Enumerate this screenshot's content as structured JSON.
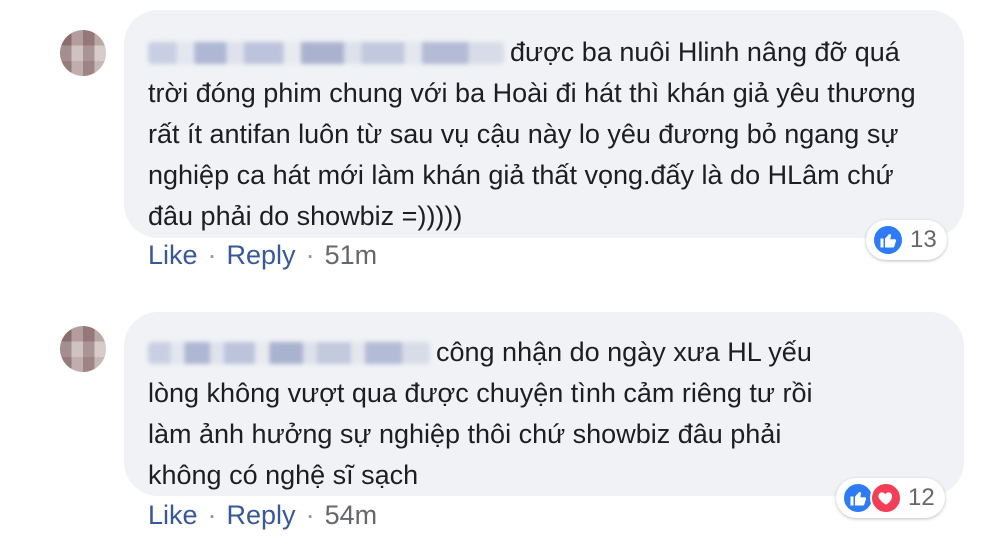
{
  "comments": [
    {
      "text": "được ba nuôi Hlinh nâng đỡ quá trời đóng phim chung với ba Hoài đi hát thì khán giả yêu thương rất ít antifan luôn từ sau vụ cậu này lo yêu đương bỏ ngang sự nghiệp ca hát mới làm khán giả thất vọng.đấy là do HLâm chứ đâu phải do showbiz =)))))",
      "like_label": "Like",
      "reply_label": "Reply",
      "separator": "·",
      "time": "51m",
      "reaction_count": "13",
      "reactions": [
        "like-icon"
      ]
    },
    {
      "text": "công nhận do ngày xưa HL yếu lòng không vượt qua được chuyện tình cảm riêng tư rồi làm ảnh hưởng sự nghiệp thôi chứ showbiz đâu phải không có nghệ sĩ sạch",
      "like_label": "Like",
      "reply_label": "Reply",
      "separator": "·",
      "time": "54m",
      "reaction_count": "12",
      "reactions": [
        "like-icon",
        "heart-icon"
      ]
    }
  ],
  "colors": {
    "bubble": "#f0f2f5",
    "link": "#385898",
    "meta": "#65676b",
    "like": "#2f7bf5",
    "love": "#f33e58"
  }
}
